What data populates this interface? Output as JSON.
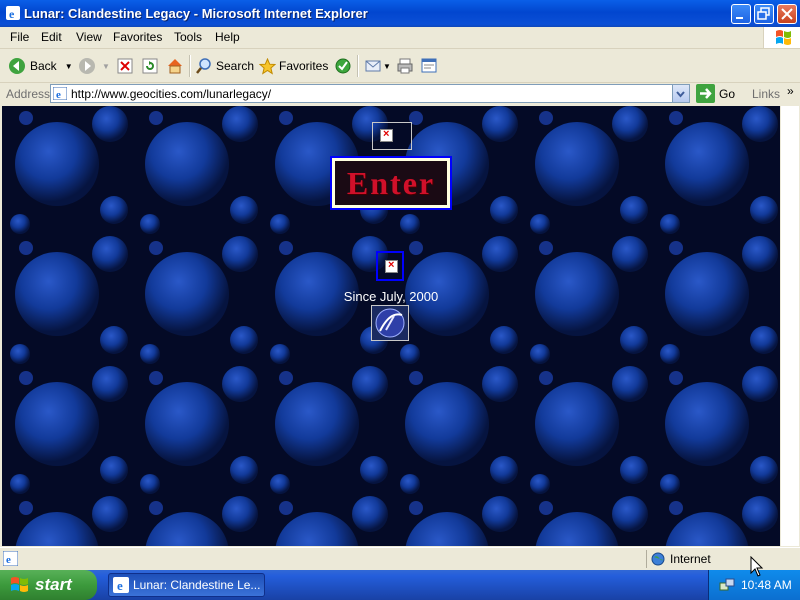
{
  "window": {
    "title": "Lunar: Clandestine Legacy - Microsoft Internet Explorer"
  },
  "menu": {
    "items": [
      "File",
      "Edit",
      "View",
      "Favorites",
      "Tools",
      "Help"
    ]
  },
  "toolbar": {
    "back_label": "Back",
    "search_label": "Search",
    "favorites_label": "Favorites"
  },
  "address": {
    "label": "Address",
    "url": "http://www.geocities.com/lunarlegacy/",
    "go_label": "Go",
    "links_label": "Links"
  },
  "page": {
    "enter_label": "Enter",
    "since_text": "Since July, 2000"
  },
  "status": {
    "zone_label": "Internet"
  },
  "taskbar": {
    "start_label": "start",
    "task_label": "Lunar: Clandestine Le...",
    "clock": "10:48 AM"
  },
  "colors": {
    "title_blue": "#0246CF",
    "enter_red": "#D0102A",
    "enter_frame": "#0000FF",
    "background_space": "#0A1C5A"
  }
}
